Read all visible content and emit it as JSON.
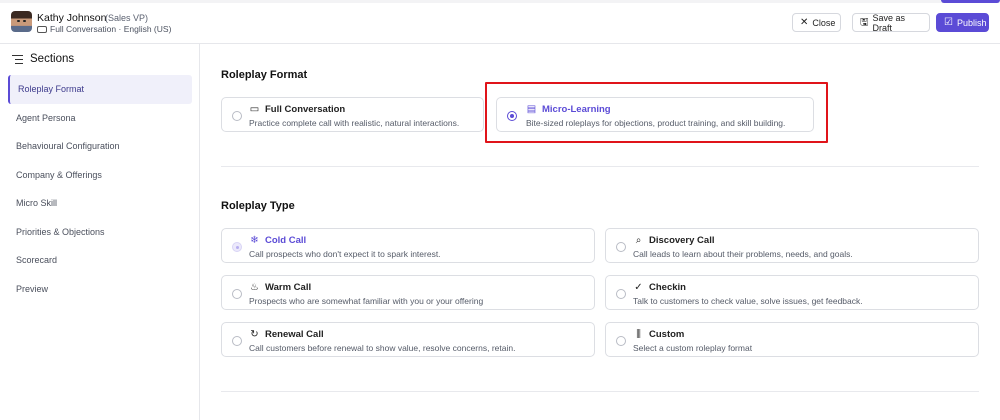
{
  "header": {
    "persona_name": "Kathy Johnson",
    "persona_role": "(Sales VP)",
    "conversation_meta": "Full Conversation · English (US)",
    "close_label": "Close",
    "save_draft_label": "Save as Draft",
    "publish_label": "Publish"
  },
  "sidebar": {
    "title": "Sections",
    "items": [
      {
        "label": "Roleplay Format",
        "active": true
      },
      {
        "label": "Agent Persona"
      },
      {
        "label": "Behavioural Configuration"
      },
      {
        "label": "Company & Offerings"
      },
      {
        "label": "Micro Skill"
      },
      {
        "label": "Priorities & Objections"
      },
      {
        "label": "Scorecard"
      },
      {
        "label": "Preview"
      }
    ]
  },
  "roleplay_format": {
    "title": "Roleplay Format",
    "options": [
      {
        "title": "Full Conversation",
        "desc": "Practice complete call with realistic, natural interactions.",
        "icon": "chat-icon",
        "selected": false
      },
      {
        "title": "Micro-Learning",
        "desc": "Bite-sized roleplays for objections, product training, and skill building.",
        "icon": "book-icon",
        "selected": true
      }
    ]
  },
  "roleplay_type": {
    "title": "Roleplay Type",
    "options": [
      {
        "title": "Cold Call",
        "desc": "Call prospects who don't expect it to spark interest.",
        "icon": "snowflake-icon",
        "selected": true
      },
      {
        "title": "Discovery Call",
        "desc": "Call leads to learn about their problems, needs, and goals.",
        "icon": "search-icon"
      },
      {
        "title": "Warm Call",
        "desc": "Prospects who are somewhat familiar with you or your offering",
        "icon": "flame-icon"
      },
      {
        "title": "Checkin",
        "desc": "Talk to customers to check value, solve issues, get feedback.",
        "icon": "check-circle-icon"
      },
      {
        "title": "Renewal Call",
        "desc": "Call customers before renewal to show value, resolve concerns, retain.",
        "icon": "refresh-icon"
      },
      {
        "title": "Custom",
        "desc": "Select a custom roleplay format",
        "icon": "sliders-icon"
      }
    ]
  },
  "colors": {
    "accent": "#5b4bd6",
    "highlight": "#e0141a"
  }
}
